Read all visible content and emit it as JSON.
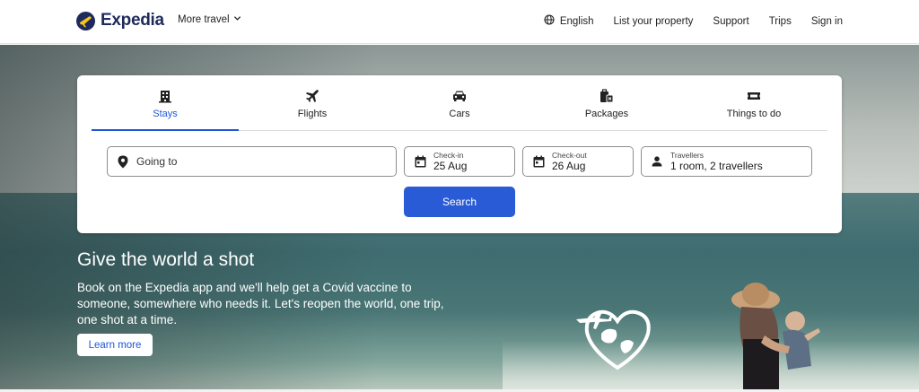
{
  "header": {
    "brand": "Expedia",
    "more_travel": "More travel",
    "nav": {
      "language": "English",
      "list_property": "List your property",
      "support": "Support",
      "trips": "Trips",
      "sign_in": "Sign in"
    }
  },
  "search": {
    "tabs": [
      {
        "label": "Stays",
        "icon": "building-icon",
        "active": true
      },
      {
        "label": "Flights",
        "icon": "plane-icon",
        "active": false
      },
      {
        "label": "Cars",
        "icon": "car-icon",
        "active": false
      },
      {
        "label": "Packages",
        "icon": "luggage-icon",
        "active": false
      },
      {
        "label": "Things to do",
        "icon": "ticket-icon",
        "active": false
      }
    ],
    "going_to": {
      "placeholder": "Going to"
    },
    "check_in": {
      "label": "Check-in",
      "value": "25 Aug"
    },
    "check_out": {
      "label": "Check-out",
      "value": "26 Aug"
    },
    "travellers": {
      "label": "Travellers",
      "value": "1 room, 2 travellers"
    },
    "search_button": "Search"
  },
  "promo": {
    "title": "Give the world a shot",
    "body": "Book on the Expedia app and we'll help get a Covid vaccine to someone, somewhere who needs it. Let's reopen the world, one trip, one shot at a time.",
    "cta": "Learn more"
  },
  "colors": {
    "brand_navy": "#1f2a5c",
    "accent_blue": "#1f57d6",
    "button_blue": "#2a5bd7"
  }
}
